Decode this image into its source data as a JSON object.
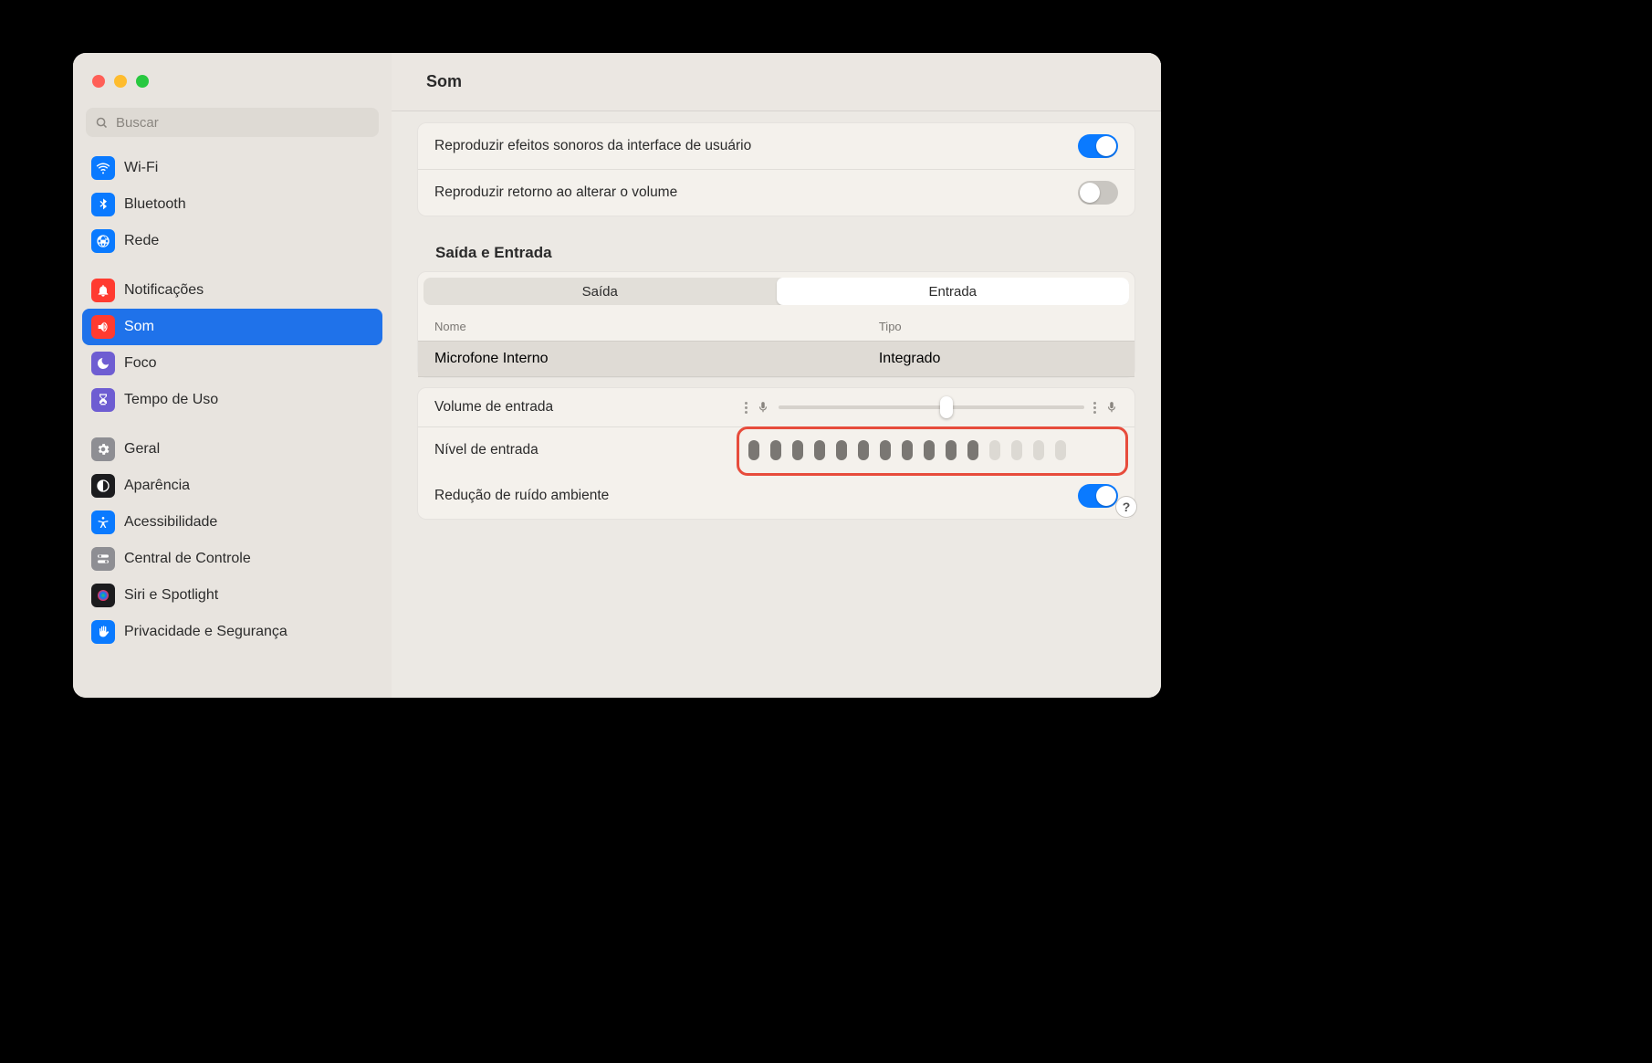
{
  "window_title": "Som",
  "search": {
    "placeholder": "Buscar"
  },
  "sidebar": {
    "items": [
      {
        "label": "Wi-Fi",
        "icon": "wifi",
        "bg": "#0a7aff"
      },
      {
        "label": "Bluetooth",
        "icon": "bluetooth",
        "bg": "#0a7aff"
      },
      {
        "label": "Rede",
        "icon": "globe",
        "bg": "#0a7aff"
      },
      {
        "label": "Notificações",
        "icon": "bell",
        "bg": "#ff3b30"
      },
      {
        "label": "Som",
        "icon": "sound",
        "bg": "#ff3b30",
        "selected": true
      },
      {
        "label": "Foco",
        "icon": "moon",
        "bg": "#6e5dd2"
      },
      {
        "label": "Tempo de Uso",
        "icon": "hourglass",
        "bg": "#6e5dd2"
      },
      {
        "label": "Geral",
        "icon": "gear",
        "bg": "#8e8e93"
      },
      {
        "label": "Aparência",
        "icon": "appearance",
        "bg": "#1c1c1e"
      },
      {
        "label": "Acessibilidade",
        "icon": "accessibility",
        "bg": "#0a7aff"
      },
      {
        "label": "Central de Controle",
        "icon": "switches",
        "bg": "#8e8e93"
      },
      {
        "label": "Siri e Spotlight",
        "icon": "siri",
        "bg": "#1c1c1e"
      },
      {
        "label": "Privacidade e Segurança",
        "icon": "hand",
        "bg": "#0a7aff"
      }
    ]
  },
  "effects_card": {
    "row1_label": "Reproduzir efeitos sonoros da interface de usuário",
    "row1_on": true,
    "row2_label": "Reproduzir retorno ao alterar o volume",
    "row2_on": false
  },
  "io_section_title": "Saída e Entrada",
  "tabs": {
    "out": "Saída",
    "in": "Entrada",
    "active": "in"
  },
  "table": {
    "col_name": "Nome",
    "col_type": "Tipo",
    "device_name": "Microfone Interno",
    "device_type": "Integrado"
  },
  "controls": {
    "input_volume_label": "Volume de entrada",
    "input_volume_pct": 55,
    "input_level_label": "Nível de entrada",
    "input_level_total": 15,
    "input_level_active": 11,
    "noise_label": "Redução de ruído ambiente",
    "noise_on": true
  },
  "help_label": "?"
}
